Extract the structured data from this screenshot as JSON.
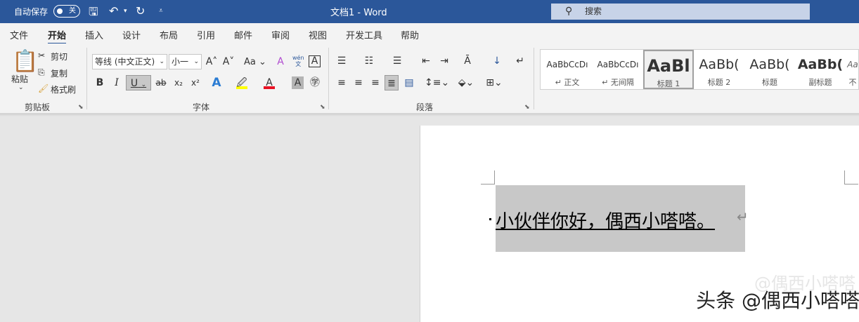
{
  "titlebar": {
    "autosave": "自动保存",
    "autosave_state": "关",
    "doc_title": "文档1  -  Word",
    "search_placeholder": "搜索"
  },
  "tabs": [
    "文件",
    "开始",
    "插入",
    "设计",
    "布局",
    "引用",
    "邮件",
    "审阅",
    "视图",
    "开发工具",
    "帮助"
  ],
  "active_tab": "开始",
  "clipboard": {
    "paste": "粘贴",
    "cut": "剪切",
    "copy": "复制",
    "format_painter": "格式刷",
    "group": "剪贴板"
  },
  "font": {
    "name": "等线 (中文正文)",
    "size": "小一",
    "case": "Aa",
    "bold": "B",
    "italic": "I",
    "underline": "U",
    "group": "字体",
    "phonetic_top": "wén",
    "phonetic_bottom": "文"
  },
  "paragraph": {
    "group": "段落"
  },
  "styles": [
    {
      "preview": "AaBbCcDı",
      "name": "↵ 正文"
    },
    {
      "preview": "AaBbCcDı",
      "name": "↵ 无间隔"
    },
    {
      "preview": "AaBl",
      "name": "标题 1"
    },
    {
      "preview": "AaBb(",
      "name": "标题 2"
    },
    {
      "preview": "AaBb(",
      "name": "标题"
    },
    {
      "preview": "AaBb(",
      "name": "副标题"
    },
    {
      "preview": "Aa",
      "name": "不"
    }
  ],
  "document": {
    "text": "小伙伴你好，偶西小嗒嗒。",
    "paragraph_mark": "↵"
  },
  "watermark": {
    "text": "头条 @偶西小嗒嗒",
    "faint": "@偶西小嗒嗒"
  },
  "colors": {
    "accent": "#2b579a",
    "highlight": "#ffff00",
    "font_color": "#e81123"
  }
}
